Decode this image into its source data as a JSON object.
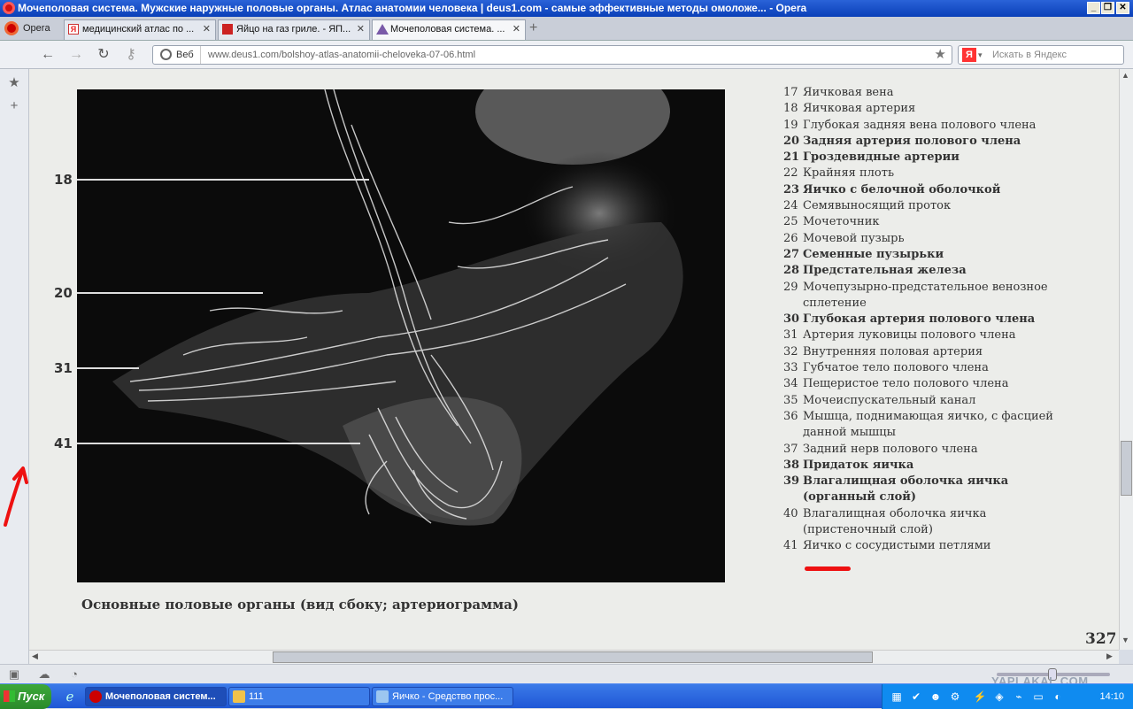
{
  "window": {
    "title": "Мочеполовая система. Мужские наружные половые органы. Атлас анатомии человека | deus1.com - самые эффективные методы омоложе... - Opera"
  },
  "tabs": {
    "menu_label": "Opera",
    "items": [
      {
        "label": "медицинский атлас по ...",
        "icon": "yandex-icon"
      },
      {
        "label": "Яйцо на газ гриле. - ЯП...",
        "icon": "yaplakal-icon"
      },
      {
        "label": "Мочеполовая система. ...",
        "icon": "deus-icon"
      }
    ]
  },
  "navbar": {
    "web_label": "Веб",
    "url": "www.deus1.com/bolshoy-atlas-anatomii-cheloveka-07-06.html",
    "search_placeholder": "Искать в Яндекс",
    "search_engine_letter": "Я"
  },
  "figure": {
    "labels": [
      {
        "num": "18"
      },
      {
        "num": "20"
      },
      {
        "num": "31"
      },
      {
        "num": "41"
      }
    ],
    "caption": "Основные половые органы (вид сбоку; артериограмма)",
    "page_number": "327"
  },
  "legend": [
    {
      "n": "17",
      "text": "Яичковая вена",
      "bold": false
    },
    {
      "n": "18",
      "text": "Яичковая артерия",
      "bold": false
    },
    {
      "n": "19",
      "text": "Глубокая задняя вена полового члена",
      "bold": false
    },
    {
      "n": "20",
      "text": "Задняя артерия полового члена",
      "bold": true
    },
    {
      "n": "21",
      "text": "Гроздевидные артерии",
      "bold": true
    },
    {
      "n": "22",
      "text": "Крайняя плоть",
      "bold": false
    },
    {
      "n": "23",
      "text": "Яичко с белочной оболочкой",
      "bold": true
    },
    {
      "n": "24",
      "text": "Семявыносящий проток",
      "bold": false
    },
    {
      "n": "25",
      "text": "Мочеточник",
      "bold": false
    },
    {
      "n": "26",
      "text": "Мочевой пузырь",
      "bold": false
    },
    {
      "n": "27",
      "text": "Семенные пузырьки",
      "bold": true
    },
    {
      "n": "28",
      "text": "Предстательная железа",
      "bold": true
    },
    {
      "n": "29",
      "text": "Мочепузырно-предстательное венозное",
      "cont": "сплетение",
      "bold": false
    },
    {
      "n": "30",
      "text": "Глубокая артерия полового члена",
      "bold": true
    },
    {
      "n": "31",
      "text": "Артерия луковицы полового члена",
      "bold": false
    },
    {
      "n": "32",
      "text": "Внутренняя половая артерия",
      "bold": false
    },
    {
      "n": "33",
      "text": "Губчатое тело полового члена",
      "bold": false
    },
    {
      "n": "34",
      "text": "Пещеристое тело полового члена",
      "bold": false
    },
    {
      "n": "35",
      "text": "Мочеиспускательный канал",
      "bold": false
    },
    {
      "n": "36",
      "text": "Мышца, поднимающая яичко, с фасцией",
      "cont": "данной мышцы",
      "bold": false
    },
    {
      "n": "37",
      "text": "Задний нерв полового члена",
      "bold": false
    },
    {
      "n": "38",
      "text": "Придаток яичка",
      "bold": true
    },
    {
      "n": "39",
      "text": "Влагалищная оболочка яичка",
      "cont": "(органный слой)",
      "bold": true
    },
    {
      "n": "40",
      "text": "Влагалищная оболочка яичка",
      "cont": "(пристеночный слой)",
      "bold": false
    },
    {
      "n": "41",
      "text": "Яичко с сосудистыми петлями",
      "bold": false
    }
  ],
  "colors": {
    "annotation_red": "#ee1111",
    "titlebar_blue": "#0a3fb8",
    "taskbar_blue": "#245edb"
  },
  "statusbar": {
    "watermark": "YAPLAKAL.COM"
  },
  "taskbar": {
    "start_label": "Пуск",
    "buttons": [
      {
        "label": "Мочеполовая систем...",
        "active": true
      },
      {
        "label": "111",
        "active": false
      },
      {
        "label": "Яичко - Средство прос...",
        "active": false
      }
    ],
    "clock": "14:10"
  }
}
